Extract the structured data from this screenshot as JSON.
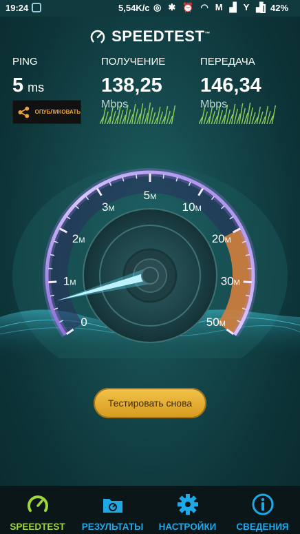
{
  "status_bar": {
    "time": "19:24",
    "net_speed": "5,54K/c",
    "carrier_letter": "Y",
    "battery": "42%"
  },
  "brand": {
    "name": "SPEEDTEST",
    "mark": "™"
  },
  "metrics": {
    "ping": {
      "label": "PING",
      "value": "5",
      "unit": "ms"
    },
    "download": {
      "label": "ПОЛУЧЕНИЕ",
      "value": "138,25",
      "unit": "Mbps"
    },
    "upload": {
      "label": "ПЕРЕДАЧА",
      "value": "146,34",
      "unit": "Mbps"
    }
  },
  "share_button": {
    "label": "ОПУБЛИКОВАТЬ",
    "icon": "share-icon"
  },
  "gauge": {
    "ticks": [
      {
        "num": "0",
        "unit": ""
      },
      {
        "num": "1",
        "unit": "М"
      },
      {
        "num": "2",
        "unit": "М"
      },
      {
        "num": "3",
        "unit": "М"
      },
      {
        "num": "5",
        "unit": "М"
      },
      {
        "num": "10",
        "unit": "М"
      },
      {
        "num": "20",
        "unit": "М"
      },
      {
        "num": "30",
        "unit": "М"
      },
      {
        "num": "50",
        "unit": "М"
      }
    ],
    "needle_fraction": 0.08,
    "colors": {
      "ring": "#b583ff",
      "hot": "#e98a3a",
      "needle": "#bff2ff"
    }
  },
  "retest_button": {
    "label": "Тестировать снова"
  },
  "nav": [
    {
      "label": "SPEEDTEST",
      "icon": "speedometer-icon",
      "active": true
    },
    {
      "label": "РЕЗУЛЬТАТЫ",
      "icon": "results-folder-icon",
      "active": false
    },
    {
      "label": "НАСТРОЙКИ",
      "icon": "gear-icon",
      "active": false
    },
    {
      "label": "СВЕДЕНИЯ",
      "icon": "info-icon",
      "active": false
    }
  ]
}
